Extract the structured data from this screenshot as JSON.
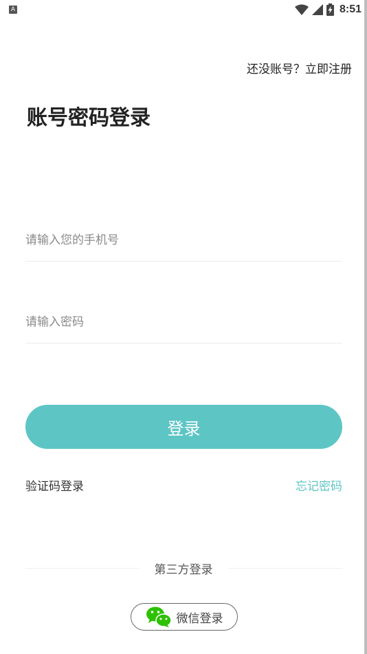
{
  "status_bar": {
    "notification_icon_label": "A",
    "time": "8:51",
    "icons": [
      "wifi-icon",
      "cell-signal-icon",
      "battery-charging-icon"
    ]
  },
  "header": {
    "register_link": "还没账号？立即注册"
  },
  "page": {
    "title": "账号密码登录"
  },
  "form": {
    "phone_placeholder": "请输入您的手机号",
    "phone_value": "",
    "password_placeholder": "请输入密码",
    "password_value": "",
    "login_button": "登录"
  },
  "links": {
    "sms_login": "验证码登录",
    "forgot_password": "忘记密码"
  },
  "third_party": {
    "divider_label": "第三方登录",
    "wechat_login": "微信登录",
    "wechat_icon": "wechat-icon"
  },
  "colors": {
    "accent": "#5ec5c5",
    "wechat_green": "#2dc100"
  }
}
